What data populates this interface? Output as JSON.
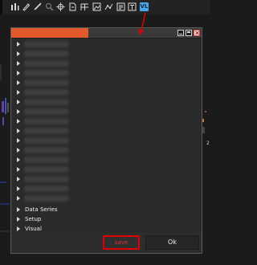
{
  "toolbar": {
    "icons": [
      "bars-icon",
      "pencil-icon",
      "ruler-icon",
      "zoom-icon",
      "crosshair-icon",
      "page-icon",
      "table-icon",
      "image-icon",
      "line-icon",
      "grid-icon",
      "text-icon"
    ],
    "vl_badge": "VL"
  },
  "dialog": {
    "tree_items": [
      {
        "label": ""
      },
      {
        "label": ""
      },
      {
        "label": ""
      },
      {
        "label": ""
      },
      {
        "label": ""
      },
      {
        "label": ""
      },
      {
        "label": ""
      },
      {
        "label": ""
      },
      {
        "label": ""
      },
      {
        "label": ""
      },
      {
        "label": ""
      },
      {
        "label": ""
      },
      {
        "label": ""
      },
      {
        "label": ""
      },
      {
        "label": ""
      },
      {
        "label": ""
      },
      {
        "label": ""
      },
      {
        "label": "Data Series"
      },
      {
        "label": "Setup"
      },
      {
        "label": "Visual"
      }
    ],
    "save_label": "save",
    "ok_label": "Ok"
  },
  "background": {
    "side_value": "2"
  },
  "colors": {
    "accent_title": "#e25a2c",
    "annotation": "#e00000",
    "vl_badge": "#4aa8e8"
  }
}
